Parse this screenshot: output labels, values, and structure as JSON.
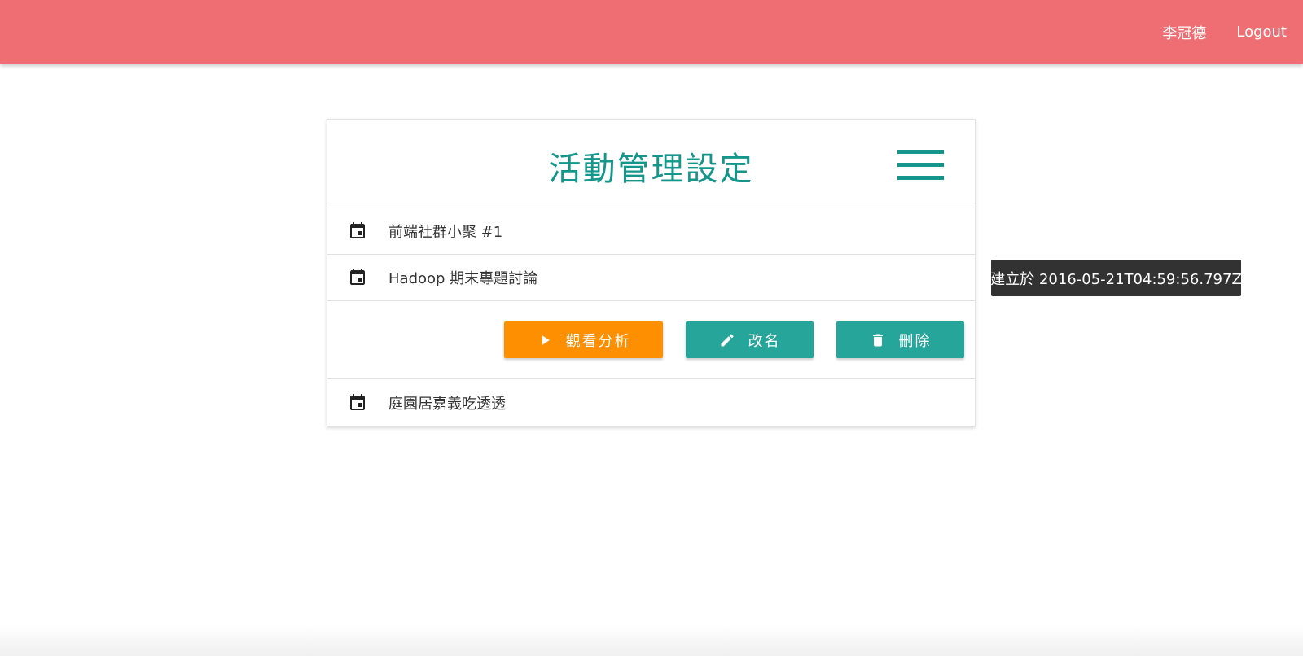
{
  "navbar": {
    "user_name": "李冠德",
    "logout_label": "Logout",
    "color": "#ef6e73"
  },
  "card": {
    "title": "活動管理設定",
    "menu_icon": "menu-icon",
    "accent_color": "#14978a"
  },
  "events": [
    {
      "name": "前端社群小聚 #1",
      "icon": "calendar-icon"
    },
    {
      "name": "Hadoop 期末專題討論",
      "icon": "calendar-icon"
    },
    {
      "name": "庭園居嘉義吃透透",
      "icon": "calendar-icon"
    }
  ],
  "actions": {
    "analysis_label": "觀看分析",
    "rename_label": "改名",
    "delete_label": "刪除",
    "analysis_color": "#fe8f00",
    "rename_color": "#26a69a",
    "delete_color": "#26a69a"
  },
  "tooltip": {
    "text": "建立於 2016-05-21T04:59:56.797Z"
  }
}
